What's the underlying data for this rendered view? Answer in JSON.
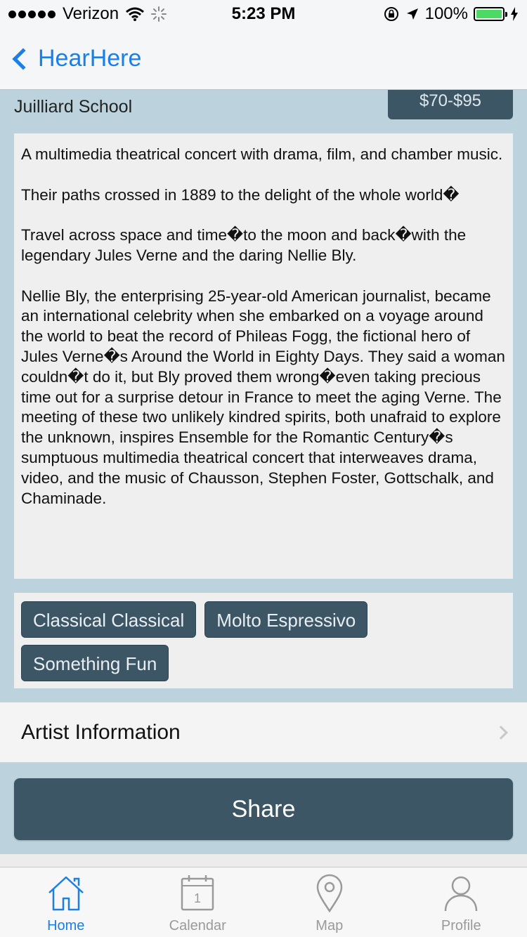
{
  "status_bar": {
    "carrier": "Verizon",
    "time": "5:23 PM",
    "battery": "100%"
  },
  "nav": {
    "back_label": "HearHere"
  },
  "event": {
    "venue": "Juilliard School",
    "price": "$70-$95",
    "description": [
      "A multimedia theatrical concert with drama, film, and chamber music.",
      "Their paths crossed in 1889 to the delight of the whole world�",
      "Travel across space and time�to the moon and back�with the legendary Jules Verne and the daring Nellie Bly.",
      "Nellie Bly, the enterprising 25-year-old American journalist, became an international celebrity when she embarked on a voyage around the world to beat the record of Phileas Fogg, the fictional hero of Jules Verne�s Around the World in Eighty Days. They said a woman couldn�t do it, but Bly proved them wrong�even taking precious time out for a surprise detour in France to meet the aging Verne. The meeting of these two unlikely kindred spirits, both unafraid to explore the unknown, inspires Ensemble for the Romantic Century�s sumptuous multimedia theatrical concert that interweaves drama, video, and the music of Chausson, Stephen Foster, Gottschalk, and Chaminade."
    ],
    "tags": [
      "Classical Classical",
      "Molto Espressivo",
      "Something Fun"
    ]
  },
  "artist_row": {
    "label": "Artist Information"
  },
  "share_button": {
    "label": "Share"
  },
  "tabs": [
    {
      "label": "Home",
      "icon": "home-icon"
    },
    {
      "label": "Calendar",
      "icon": "calendar-icon",
      "badge": "1"
    },
    {
      "label": "Map",
      "icon": "map-pin-icon"
    },
    {
      "label": "Profile",
      "icon": "profile-icon"
    }
  ],
  "colors": {
    "accent": "#1a7fe6",
    "button": "#3d5666",
    "background": "#bcd3dd"
  }
}
